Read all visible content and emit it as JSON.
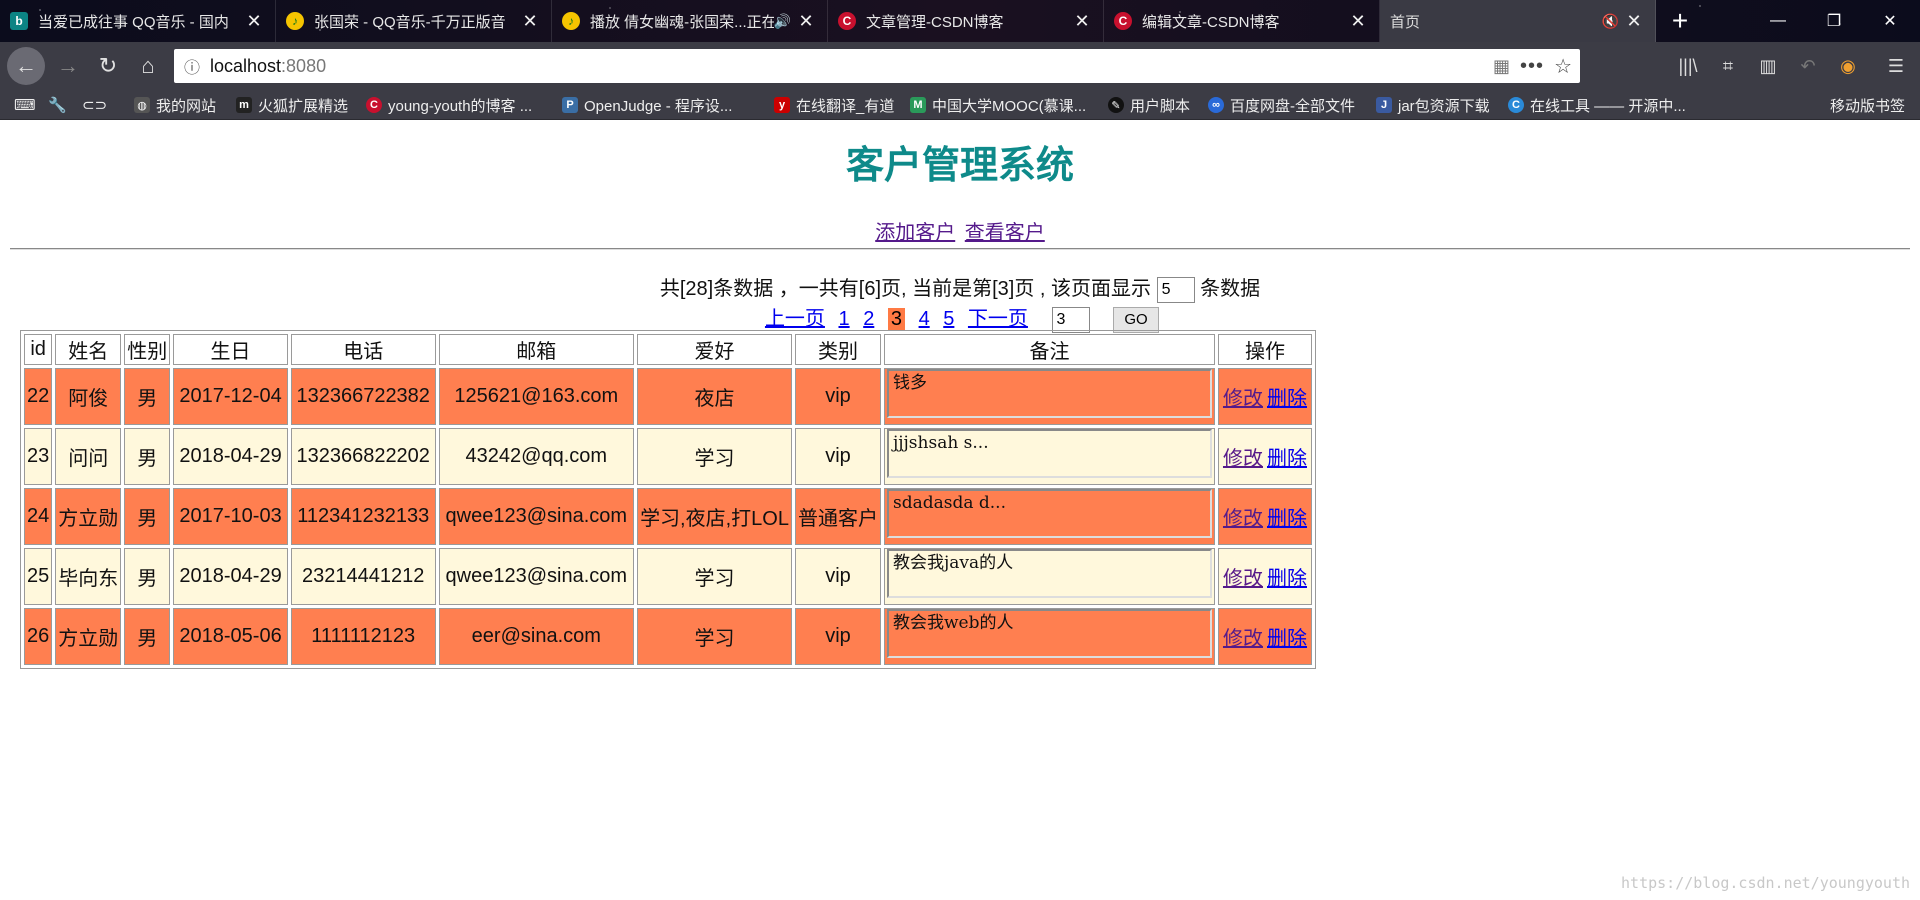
{
  "browser": {
    "tabs": [
      {
        "title": "当爱已成往事 QQ音乐 - 国内",
        "favicon": "bing"
      },
      {
        "title": "张国荣 - QQ音乐-千万正版音",
        "favicon": "qq"
      },
      {
        "title": "播放 倩女幽魂-张国荣...正在",
        "favicon": "qq"
      },
      {
        "title": "文章管理-CSDN博客",
        "favicon": "csdn"
      },
      {
        "title": "编辑文章-CSDN博客",
        "favicon": "csdn"
      },
      {
        "title": "首页",
        "favicon": "none"
      }
    ],
    "url": {
      "host": "localhost",
      "port": ":8080"
    },
    "bookmarks": [
      {
        "label": "我的网站"
      },
      {
        "label": "火狐扩展精选"
      },
      {
        "label": "young-youth的博客 ..."
      },
      {
        "label": "OpenJudge - 程序设..."
      },
      {
        "label": "在线翻译_有道"
      },
      {
        "label": "中国大学MOOC(慕课..."
      },
      {
        "label": "用户脚本"
      },
      {
        "label": "百度网盘-全部文件"
      },
      {
        "label": "jar包资源下载"
      },
      {
        "label": "在线工具 —— 开源中..."
      }
    ],
    "mobile_bookmarks": "移动版书签"
  },
  "page": {
    "title": "客户管理系统",
    "links": {
      "add": "添加客户",
      "view": "查看客户"
    },
    "summary": {
      "prefix": "共[28]条数据 ，一共有[6]页, 当前是第[3]页 , 该页面显示",
      "page_size": "5",
      "suffix": "条数据"
    },
    "pager": {
      "prev": "上一页",
      "pages": [
        "1",
        "2",
        "3",
        "4",
        "5"
      ],
      "current": "3",
      "next": "下一页",
      "goto_value": "3",
      "go_label": "GO"
    },
    "table": {
      "headers": [
        "id",
        "姓名",
        "性别",
        "生日",
        "电话",
        "邮箱",
        "爱好",
        "类别",
        "备注",
        "操作"
      ],
      "rows": [
        {
          "id": "22",
          "name": "阿俊",
          "gender": "男",
          "birthday": "2017-12-04",
          "phone": "132366722382",
          "email": "125621@163.com",
          "hobby": "夜店",
          "type": "vip",
          "note": "钱多"
        },
        {
          "id": "23",
          "name": "问问",
          "gender": "男",
          "birthday": "2018-04-29",
          "phone": "132366822202",
          "email": "43242@qq.com",
          "hobby": "学习",
          "type": "vip",
          "note": "jjjshsah s..."
        },
        {
          "id": "24",
          "name": "方立勋",
          "gender": "男",
          "birthday": "2017-10-03",
          "phone": "112341232133",
          "email": "qwee123@sina.com",
          "hobby": "学习,夜店,打LOL",
          "type": "普通客户",
          "note": "sdadasda d..."
        },
        {
          "id": "25",
          "name": "毕向东",
          "gender": "男",
          "birthday": "2018-04-29",
          "phone": "23214441212",
          "email": "qwee123@sina.com",
          "hobby": "学习",
          "type": "vip",
          "note": "教会我java的人"
        },
        {
          "id": "26",
          "name": "方立勋",
          "gender": "男",
          "birthday": "2018-05-06",
          "phone": "1111112123",
          "email": "eer@sina.com",
          "hobby": "学习",
          "type": "vip",
          "note": "教会我web的人"
        }
      ],
      "actions": {
        "edit": "修改",
        "delete": "删除"
      }
    },
    "watermark": "https://blog.csdn.net/youngyouth"
  },
  "colors": {
    "title": "#0e8a8a",
    "row_odd": "#ff7f50",
    "row_even": "#fff8dc",
    "current_page": "#ff7a44"
  }
}
